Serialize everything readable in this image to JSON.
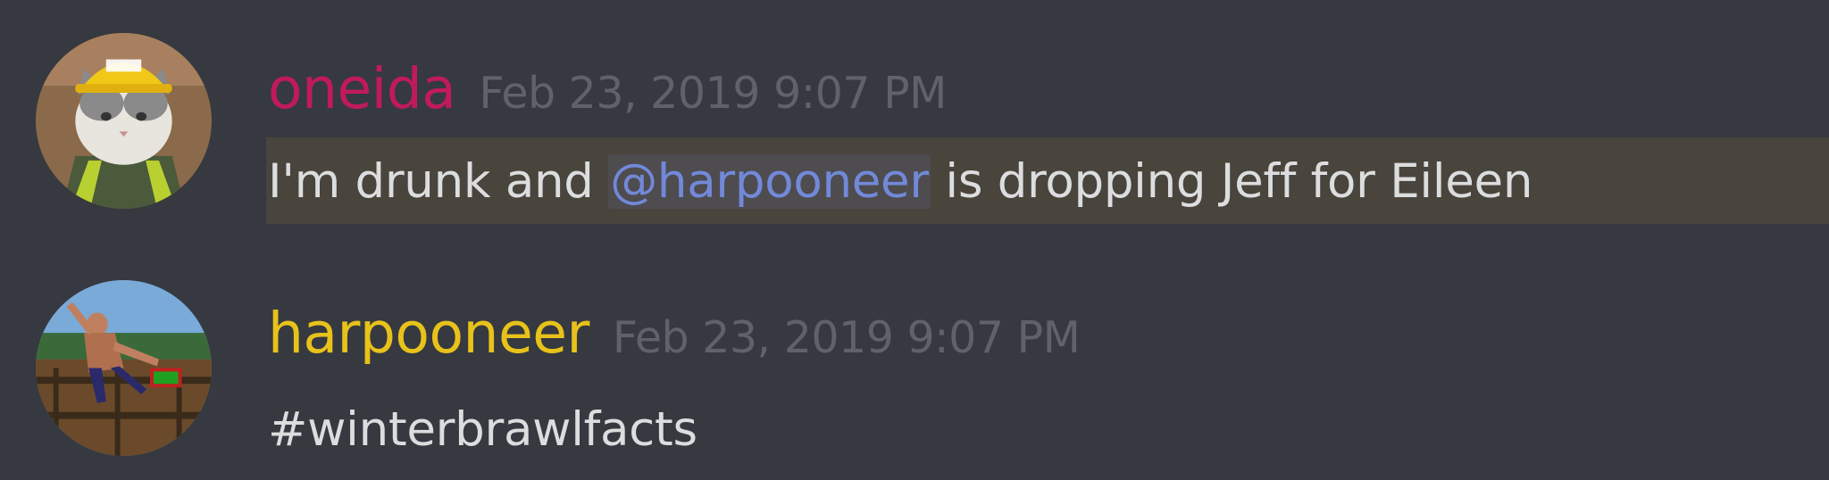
{
  "colors": {
    "background": "#36393f",
    "mention_highlight_bar": "#49443c",
    "mention_text": "#7289da",
    "message_text": "#dcddde",
    "timestamp": "#5f6269"
  },
  "messages": [
    {
      "author": "oneida",
      "author_color": "#c01a5d",
      "avatar_icon": "cat-hardhat-avatar",
      "timestamp": "Feb 23, 2019 9:07 PM",
      "content_before": "I'm drunk and ",
      "mention": "@harpooneer",
      "content_after": " is dropping Jeff for Eileen",
      "highlighted": true
    },
    {
      "author": "harpooneer",
      "author_color": "#e8c21a",
      "avatar_icon": "fighter-game-avatar",
      "timestamp": "Feb 23, 2019 9:07 PM",
      "content": "#winterbrawlfacts",
      "highlighted": false
    }
  ]
}
